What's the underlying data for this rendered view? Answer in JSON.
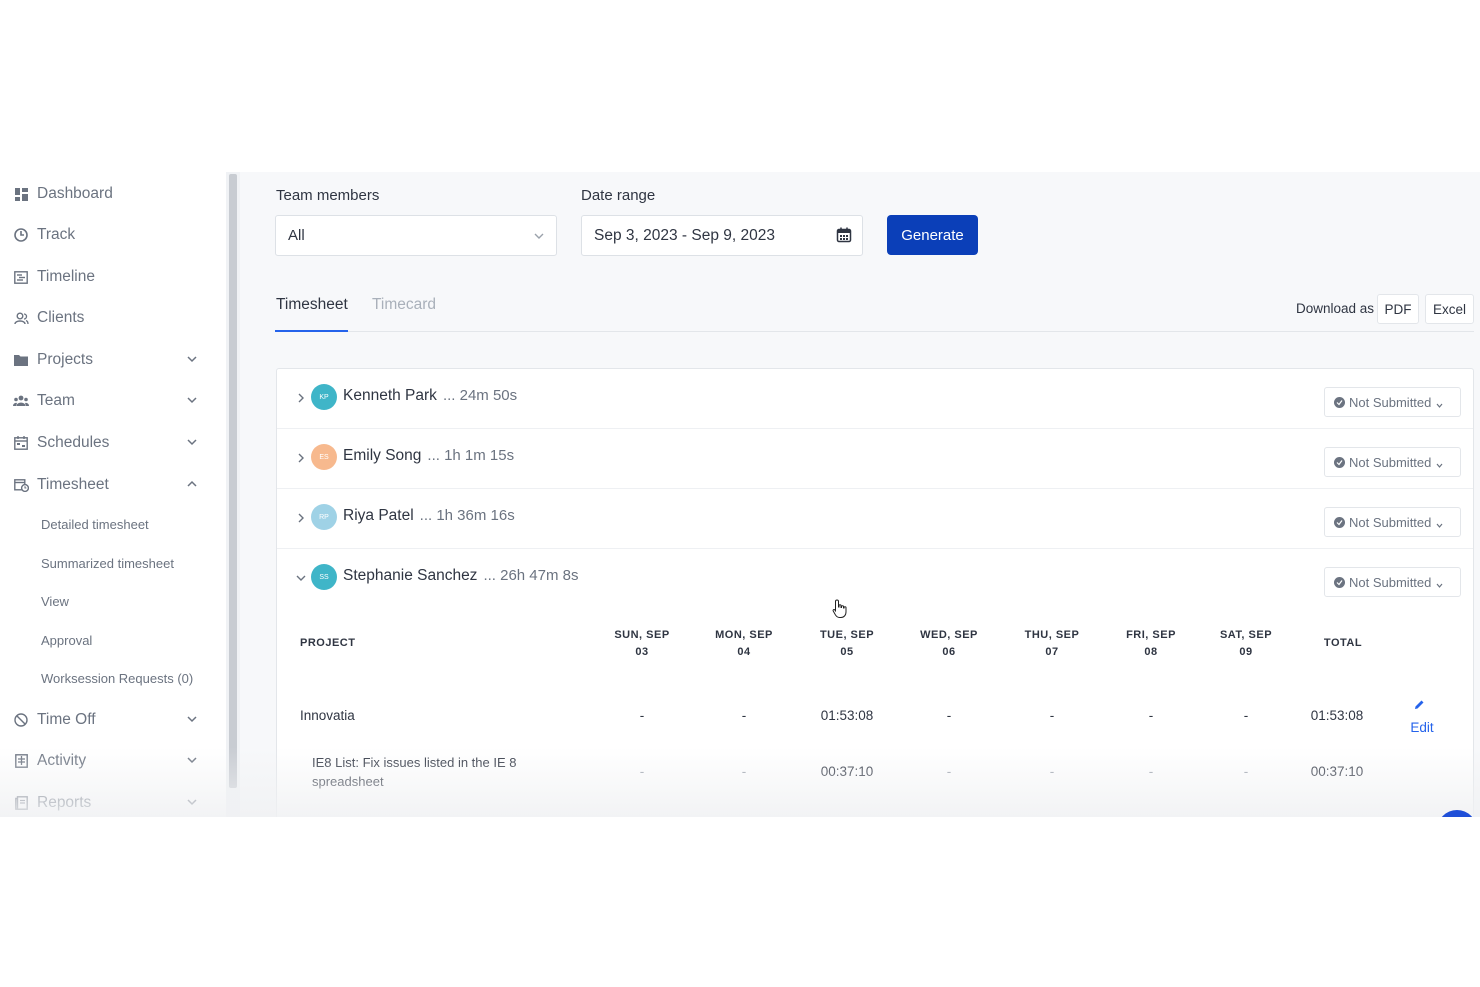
{
  "sidebar": {
    "items": [
      {
        "label": "Dashboard",
        "icon": "dashboard-icon",
        "chevron": ""
      },
      {
        "label": "Track",
        "icon": "clock-icon",
        "chevron": ""
      },
      {
        "label": "Timeline",
        "icon": "timeline-icon",
        "chevron": ""
      },
      {
        "label": "Clients",
        "icon": "clients-icon",
        "chevron": ""
      },
      {
        "label": "Projects",
        "icon": "folder-icon",
        "chevron": "down"
      },
      {
        "label": "Team",
        "icon": "team-icon",
        "chevron": "down"
      },
      {
        "label": "Schedules",
        "icon": "schedule-icon",
        "chevron": "down"
      },
      {
        "label": "Timesheet",
        "icon": "timesheet-icon",
        "chevron": "up"
      },
      {
        "label": "Time Off",
        "icon": "time-off-icon",
        "chevron": "down"
      },
      {
        "label": "Activity",
        "icon": "activity-icon",
        "chevron": "down"
      },
      {
        "label": "Reports",
        "icon": "reports-icon",
        "chevron": "down"
      }
    ],
    "timesheet_subitems": [
      "Detailed timesheet",
      "Summarized timesheet",
      "View",
      "Approval",
      "Worksession Requests (0)"
    ]
  },
  "filters": {
    "team_members_label": "Team members",
    "team_members_value": "All",
    "date_range_label": "Date range",
    "date_range_value": "Sep 3, 2023 - Sep 9, 2023",
    "generate_label": "Generate"
  },
  "tabs": {
    "timesheet": "Timesheet",
    "timecard": "Timecard",
    "active": "Timesheet"
  },
  "download": {
    "label": "Download as",
    "pdf": "PDF",
    "excel": "Excel"
  },
  "members": [
    {
      "initials": "KP",
      "name": "Kenneth Park",
      "time": "... 24m 50s",
      "status": "Not Submitted",
      "color": "#3fb5c8",
      "expanded": false
    },
    {
      "initials": "ES",
      "name": "Emily Song",
      "time": "... 1h 1m 15s",
      "status": "Not Submitted",
      "color": "#f7b98e",
      "expanded": false
    },
    {
      "initials": "RP",
      "name": "Riya Patel",
      "time": "... 1h 36m 16s",
      "status": "Not Submitted",
      "color": "#9fd2e6",
      "expanded": false
    },
    {
      "initials": "SS",
      "name": "Stephanie Sanchez",
      "time": "... 26h 47m 8s",
      "status": "Not Submitted",
      "color": "#3fb5c8",
      "expanded": true
    }
  ],
  "table": {
    "headers": {
      "project": "PROJECT",
      "days": [
        [
          "SUN, SEP",
          "03"
        ],
        [
          "MON, SEP",
          "04"
        ],
        [
          "TUE, SEP",
          "05"
        ],
        [
          "WED, SEP",
          "06"
        ],
        [
          "THU, SEP",
          "07"
        ],
        [
          "FRI, SEP",
          "08"
        ],
        [
          "SAT, SEP",
          "09"
        ]
      ],
      "total": "TOTAL"
    },
    "rows": [
      {
        "project": "Innovatia",
        "values": [
          "-",
          "-",
          "01:53:08",
          "-",
          "-",
          "-",
          "-"
        ],
        "total": "01:53:08",
        "edit": "Edit"
      },
      {
        "project": "IE8 List: Fix issues listed in the IE 8 spreadsheet",
        "values": [
          "-",
          "-",
          "00:37:10",
          "-",
          "-",
          "-",
          "-"
        ],
        "total": "00:37:10"
      }
    ]
  },
  "colors": {
    "primary": "#0b3fb8",
    "accent_link": "#2563eb",
    "muted_text": "#6b7380"
  }
}
